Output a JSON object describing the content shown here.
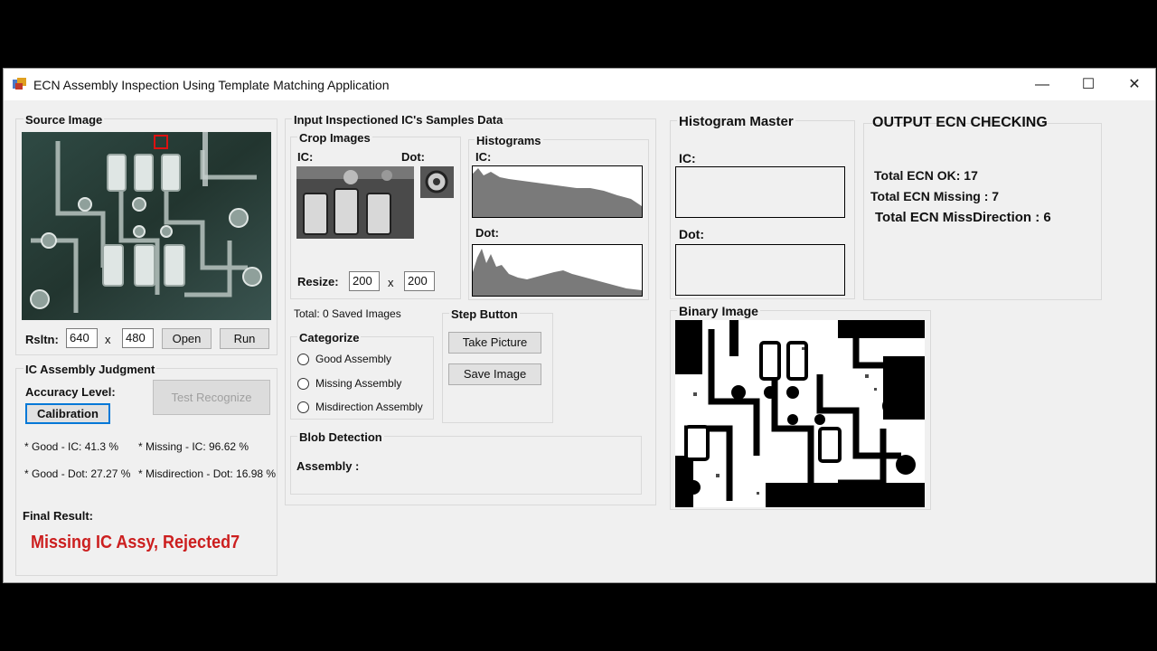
{
  "window": {
    "title": "ECN Assembly Inspection Using Template Matching Application",
    "minimize": "—",
    "maximize": "☐",
    "close": "✕"
  },
  "source": {
    "title": "Source Image",
    "resolution_label": "Rsltn:",
    "width": "640",
    "times": "x",
    "height": "480",
    "open_label": "Open",
    "run_label": "Run"
  },
  "judgment": {
    "title": "IC Assembly Judgment",
    "accuracy_label": "Accuracy Level:",
    "calibration_label": "Calibration",
    "test_label": "Test Recognize",
    "good_ic": "* Good - IC: 41.3 %",
    "missing_ic": "* Missing - IC: 96.62 %",
    "good_dot": "* Good - Dot: 27.27 %",
    "misdirection_dot": "* Misdirection - Dot: 16.98 %",
    "final_label": "Final Result:",
    "final_value": "Missing IC Assy, Rejected7",
    "final_color": "#cc1f1f"
  },
  "samples": {
    "title": "Input Inspectioned IC's Samples Data",
    "crop_title": "Crop Images",
    "ic_label": "IC:",
    "dot_label": "Dot:",
    "resize_label": "Resize:",
    "resize_w": "200",
    "times": "x",
    "resize_h": "200",
    "histograms_title": "Histograms",
    "hist_ic_label": "IC:",
    "hist_dot_label": "Dot:",
    "total_saved": "Total: 0 Saved Images",
    "categorize_title": "Categorize",
    "options": [
      "Good Assembly",
      "Missing Assembly",
      "Misdirection Assembly"
    ],
    "step_title": "Step Button",
    "take_picture": "Take Picture",
    "save_image": "Save Image",
    "blob_title": "Blob Detection",
    "assembly_label": "Assembly :"
  },
  "histogram_master": {
    "title": "Histogram Master",
    "ic_label": "IC:",
    "dot_label": "Dot:"
  },
  "binary": {
    "title": "Binary Image"
  },
  "output": {
    "title": "OUTPUT ECN CHECKING",
    "ok": "Total ECN OK: 17",
    "missing": "Total ECN Missing : 7",
    "missdirection": "Total ECN MissDirection : 6"
  }
}
